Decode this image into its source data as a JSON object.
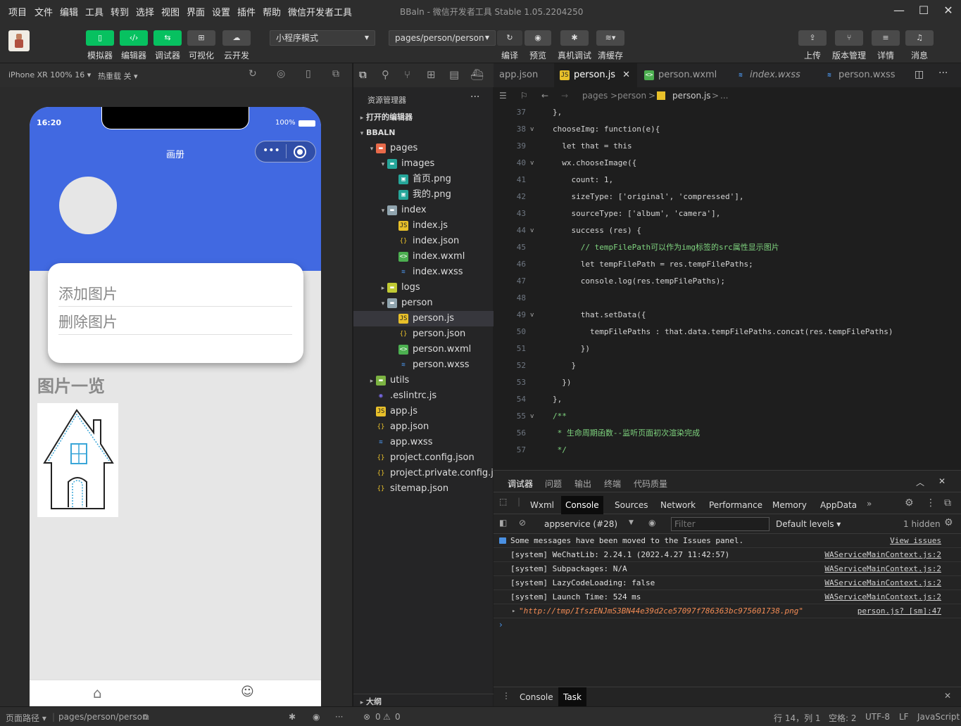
{
  "menubar": {
    "items": [
      "项目",
      "文件",
      "编辑",
      "工具",
      "转到",
      "选择",
      "视图",
      "界面",
      "设置",
      "插件",
      "帮助",
      "微信开发者工具"
    ],
    "title": "BBaln - 微信开发者工具 Stable 1.05.2204250"
  },
  "toolbar": {
    "simulator": "模拟器",
    "editor": "编辑器",
    "debugger": "调试器",
    "visual": "可视化",
    "cloud": "云开发",
    "mode": "小程序模式",
    "page": "pages/person/person",
    "compile": "编译",
    "preview": "预览",
    "device_debug": "真机调试",
    "clear_cache": "清缓存",
    "upload": "上传",
    "version": "版本管理",
    "details": "详情",
    "messages": "消息"
  },
  "simbar": {
    "device": "iPhone XR 100% 16 ▾",
    "hotreload": "热重载 关 ▾"
  },
  "phone": {
    "time": "16:20",
    "battery": "100%",
    "nav_title": "画册",
    "menu_add": "添加图片",
    "menu_delete": "删除图片",
    "section_title": "图片一览"
  },
  "explorer": {
    "title": "资源管理器",
    "open_editors": "打开的编辑器",
    "project": "BBALN",
    "outline": "大纲",
    "tree": [
      {
        "label": "pages",
        "indent": 1,
        "kind": "folder-red",
        "arrow": "▾"
      },
      {
        "label": "images",
        "indent": 2,
        "kind": "folder-img",
        "arrow": "▾"
      },
      {
        "label": "首页.png",
        "indent": 3,
        "kind": "png",
        "arrow": ""
      },
      {
        "label": "我的.png",
        "indent": 3,
        "kind": "png",
        "arrow": ""
      },
      {
        "label": "index",
        "indent": 2,
        "kind": "folder",
        "arrow": "▾"
      },
      {
        "label": "index.js",
        "indent": 3,
        "kind": "js",
        "arrow": ""
      },
      {
        "label": "index.json",
        "indent": 3,
        "kind": "json",
        "arrow": ""
      },
      {
        "label": "index.wxml",
        "indent": 3,
        "kind": "wxml",
        "arrow": ""
      },
      {
        "label": "index.wxss",
        "indent": 3,
        "kind": "wxss",
        "arrow": ""
      },
      {
        "label": "logs",
        "indent": 2,
        "kind": "folder-logs",
        "arrow": "▸"
      },
      {
        "label": "person",
        "indent": 2,
        "kind": "folder",
        "arrow": "▾"
      },
      {
        "label": "person.js",
        "indent": 3,
        "kind": "js",
        "arrow": "",
        "selected": true
      },
      {
        "label": "person.json",
        "indent": 3,
        "kind": "json",
        "arrow": ""
      },
      {
        "label": "person.wxml",
        "indent": 3,
        "kind": "wxml",
        "arrow": ""
      },
      {
        "label": "person.wxss",
        "indent": 3,
        "kind": "wxss",
        "arrow": ""
      },
      {
        "label": "utils",
        "indent": 1,
        "kind": "folder-utils",
        "arrow": "▸"
      },
      {
        "label": ".eslintrc.js",
        "indent": 1,
        "kind": "eslint",
        "arrow": ""
      },
      {
        "label": "app.js",
        "indent": 1,
        "kind": "js",
        "arrow": ""
      },
      {
        "label": "app.json",
        "indent": 1,
        "kind": "json",
        "arrow": ""
      },
      {
        "label": "app.wxss",
        "indent": 1,
        "kind": "wxss",
        "arrow": ""
      },
      {
        "label": "project.config.json",
        "indent": 1,
        "kind": "json",
        "arrow": ""
      },
      {
        "label": "project.private.config.js...",
        "indent": 1,
        "kind": "json",
        "arrow": ""
      },
      {
        "label": "sitemap.json",
        "indent": 1,
        "kind": "json",
        "arrow": ""
      }
    ]
  },
  "editor": {
    "tabs": [
      "app.json",
      "person.js",
      "person.wxml",
      "index.wxss",
      "person.wxss"
    ],
    "breadcrumb": [
      "pages",
      ">",
      "person",
      ">",
      "person.js",
      ">",
      "..."
    ],
    "lines": [
      {
        "n": "37",
        "fold": "",
        "html": "},"
      },
      {
        "n": "38",
        "fold": "v",
        "html": "chooseImg: function(e){"
      },
      {
        "n": "39",
        "fold": "",
        "html": "  let that = this"
      },
      {
        "n": "40",
        "fold": "v",
        "html": "  wx.chooseImage({"
      },
      {
        "n": "41",
        "fold": "",
        "html": "    count: 1,"
      },
      {
        "n": "42",
        "fold": "",
        "html": "    sizeType: ['original', 'compressed'],"
      },
      {
        "n": "43",
        "fold": "",
        "html": "    sourceType: ['album', 'camera'],"
      },
      {
        "n": "44",
        "fold": "v",
        "html": "    success (res) {"
      },
      {
        "n": "45",
        "fold": "",
        "html": "      // tempFilePath可以作为img标签的src属性显示图片"
      },
      {
        "n": "46",
        "fold": "",
        "html": "      let tempFilePath = res.tempFilePaths;"
      },
      {
        "n": "47",
        "fold": "",
        "html": "      console.log(res.tempFilePaths);"
      },
      {
        "n": "48",
        "fold": "",
        "html": ""
      },
      {
        "n": "49",
        "fold": "v",
        "html": "      that.setData({"
      },
      {
        "n": "50",
        "fold": "",
        "html": "        tempFilePaths : that.data.tempFilePaths.concat(res.tempFilePaths)"
      },
      {
        "n": "51",
        "fold": "",
        "html": "      })"
      },
      {
        "n": "52",
        "fold": "",
        "html": "    }"
      },
      {
        "n": "53",
        "fold": "",
        "html": "  })"
      },
      {
        "n": "54",
        "fold": "",
        "html": "},"
      },
      {
        "n": "55",
        "fold": "v",
        "html": "/**"
      },
      {
        "n": "56",
        "fold": "",
        "html": " * 生命周期函数--监听页面初次渲染完成"
      },
      {
        "n": "57",
        "fold": "",
        "html": " */"
      }
    ]
  },
  "devtools": {
    "top_tabs": [
      "调试器",
      "问题",
      "输出",
      "终端",
      "代码质量"
    ],
    "panels": [
      "Wxml",
      "Console",
      "Sources",
      "Network",
      "Performance",
      "Memory",
      "AppData"
    ],
    "context": "appservice (#28)",
    "filter_placeholder": "Filter",
    "levels": "Default levels ▾",
    "hidden": "1 hidden",
    "console": [
      {
        "text": "Some messages have been moved to the Issues panel.",
        "src": "View issues"
      },
      {
        "text": "[system] WeChatLib: 2.24.1 (2022.4.27 11:42:57)",
        "src": "WAServiceMainContext.js:2"
      },
      {
        "text": "[system] Subpackages: N/A",
        "src": "WAServiceMainContext.js:2"
      },
      {
        "text": "[system] LazyCodeLoading: false",
        "src": "WAServiceMainContext.js:2"
      },
      {
        "text": "[system] Launch Time: 524 ms",
        "src": "WAServiceMainContext.js:2"
      },
      {
        "text": "\"http://tmp/IfszENJmS3BN44e39d2ce57097f786363bc975601738.png\"",
        "src": "person.js? [sm]:47"
      }
    ],
    "bottom_tabs": [
      "Console",
      "Task"
    ]
  },
  "statusbar": {
    "path_label": "页面路径 ▾",
    "path": "pages/person/person",
    "errors": "0",
    "warnings": "0",
    "cursor": "行 14，列 1",
    "spaces": "空格: 2",
    "encoding": "UTF-8",
    "eol": "LF",
    "language": "JavaScript"
  }
}
